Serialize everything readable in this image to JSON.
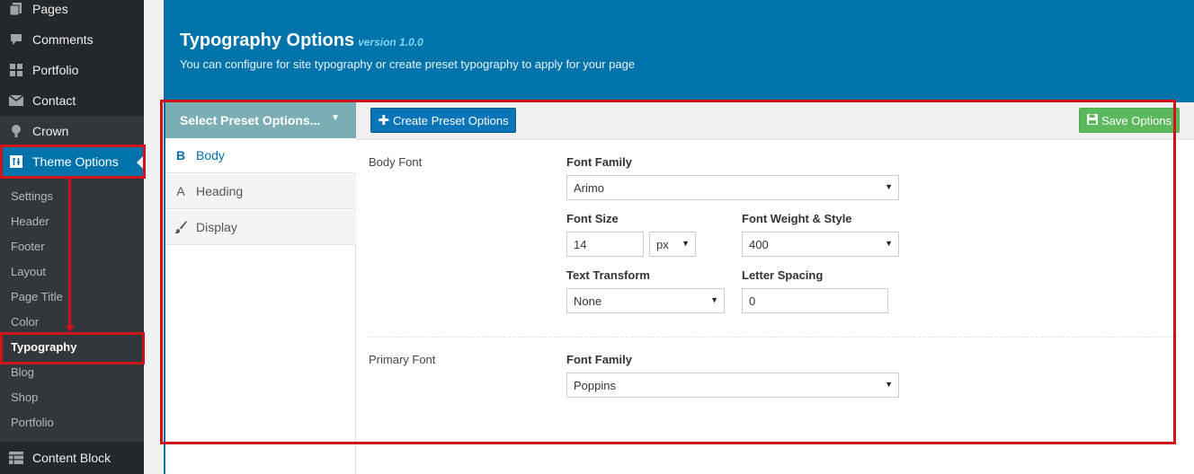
{
  "sidebar": {
    "items": [
      {
        "label": "Pages",
        "icon": "pages-icon"
      },
      {
        "label": "Comments",
        "icon": "comments-icon"
      },
      {
        "label": "Portfolio",
        "icon": "portfolio-icon"
      },
      {
        "label": "Contact",
        "icon": "mail-icon"
      },
      {
        "label": "Crown",
        "icon": "crown-icon"
      },
      {
        "label": "Theme Options",
        "icon": "theme-options-icon"
      }
    ],
    "submenu": [
      "Settings",
      "Header",
      "Footer",
      "Layout",
      "Page Title",
      "Color",
      "Typography",
      "Blog",
      "Shop",
      "Portfolio"
    ],
    "bottom": {
      "label": "Content Block",
      "icon": "table-icon"
    }
  },
  "header": {
    "title": "Typography Options",
    "version": "version 1.0.0",
    "subtitle": "You can configure for site typography or create preset typography to apply for your page"
  },
  "preset": {
    "label": "Select Preset Options..."
  },
  "nav": [
    {
      "label": "Body",
      "icon_glyph": "B"
    },
    {
      "label": "Heading",
      "icon_glyph": "A"
    },
    {
      "label": "Display",
      "icon_glyph": ""
    }
  ],
  "toolbar": {
    "create_label": "Create Preset Options",
    "save_label": "Save Options"
  },
  "body_font": {
    "section_label": "Body Font",
    "family_label": "Font Family",
    "family_value": "Arimo",
    "size_label": "Font Size",
    "size_value": "14",
    "size_unit": "px",
    "weight_label": "Font Weight & Style",
    "weight_value": "400",
    "transform_label": "Text Transform",
    "transform_value": "None",
    "spacing_label": "Letter Spacing",
    "spacing_value": "0"
  },
  "primary_font": {
    "section_label": "Primary Font",
    "family_label": "Font Family",
    "family_value": "Poppins"
  },
  "colors": {
    "wp_admin_dark": "#23282d",
    "wp_blue": "#0073aa",
    "save_green": "#5cb85c",
    "annotation_red": "#d0121a"
  }
}
